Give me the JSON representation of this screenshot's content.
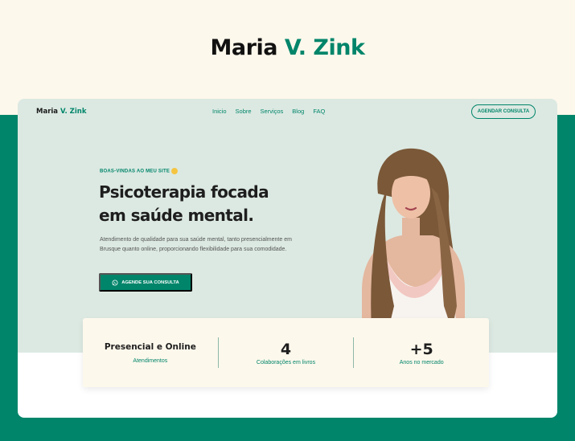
{
  "showcase": {
    "title_name": "Maria",
    "title_accent": "V. Zink"
  },
  "colors": {
    "brand_green": "#00856a",
    "cream": "#fdf8ec",
    "hero_mint": "#dce9e2"
  },
  "nav": {
    "logo_name": "Maria",
    "logo_accent": "V. Zink",
    "links": [
      "Inicio",
      "Sobre",
      "Serviços",
      "Blog",
      "FAQ"
    ],
    "cta_label": "AGENDAR CONSULTA"
  },
  "hero": {
    "eyebrow": "BOAS-VINDAS AO MEU SITE",
    "eyebrow_icon": "waving-hand-emoji",
    "headline_line1": "Psicoterapia focada",
    "headline_line2": "em saúde mental.",
    "description": "Atendimento de qualidade para sua saúde mental, tanto presencialmente em Brusque quanto online, proporcionando flexibilidade para sua comodidade.",
    "cta_label": "AGENDE SUA CONSULTA",
    "cta_icon": "whatsapp-icon"
  },
  "stats": [
    {
      "value": "Presencial e Online",
      "label": "Atendimentos"
    },
    {
      "value": "4",
      "label": "Colaborações em livros"
    },
    {
      "value": "+5",
      "label": "Anos no mercado"
    }
  ]
}
